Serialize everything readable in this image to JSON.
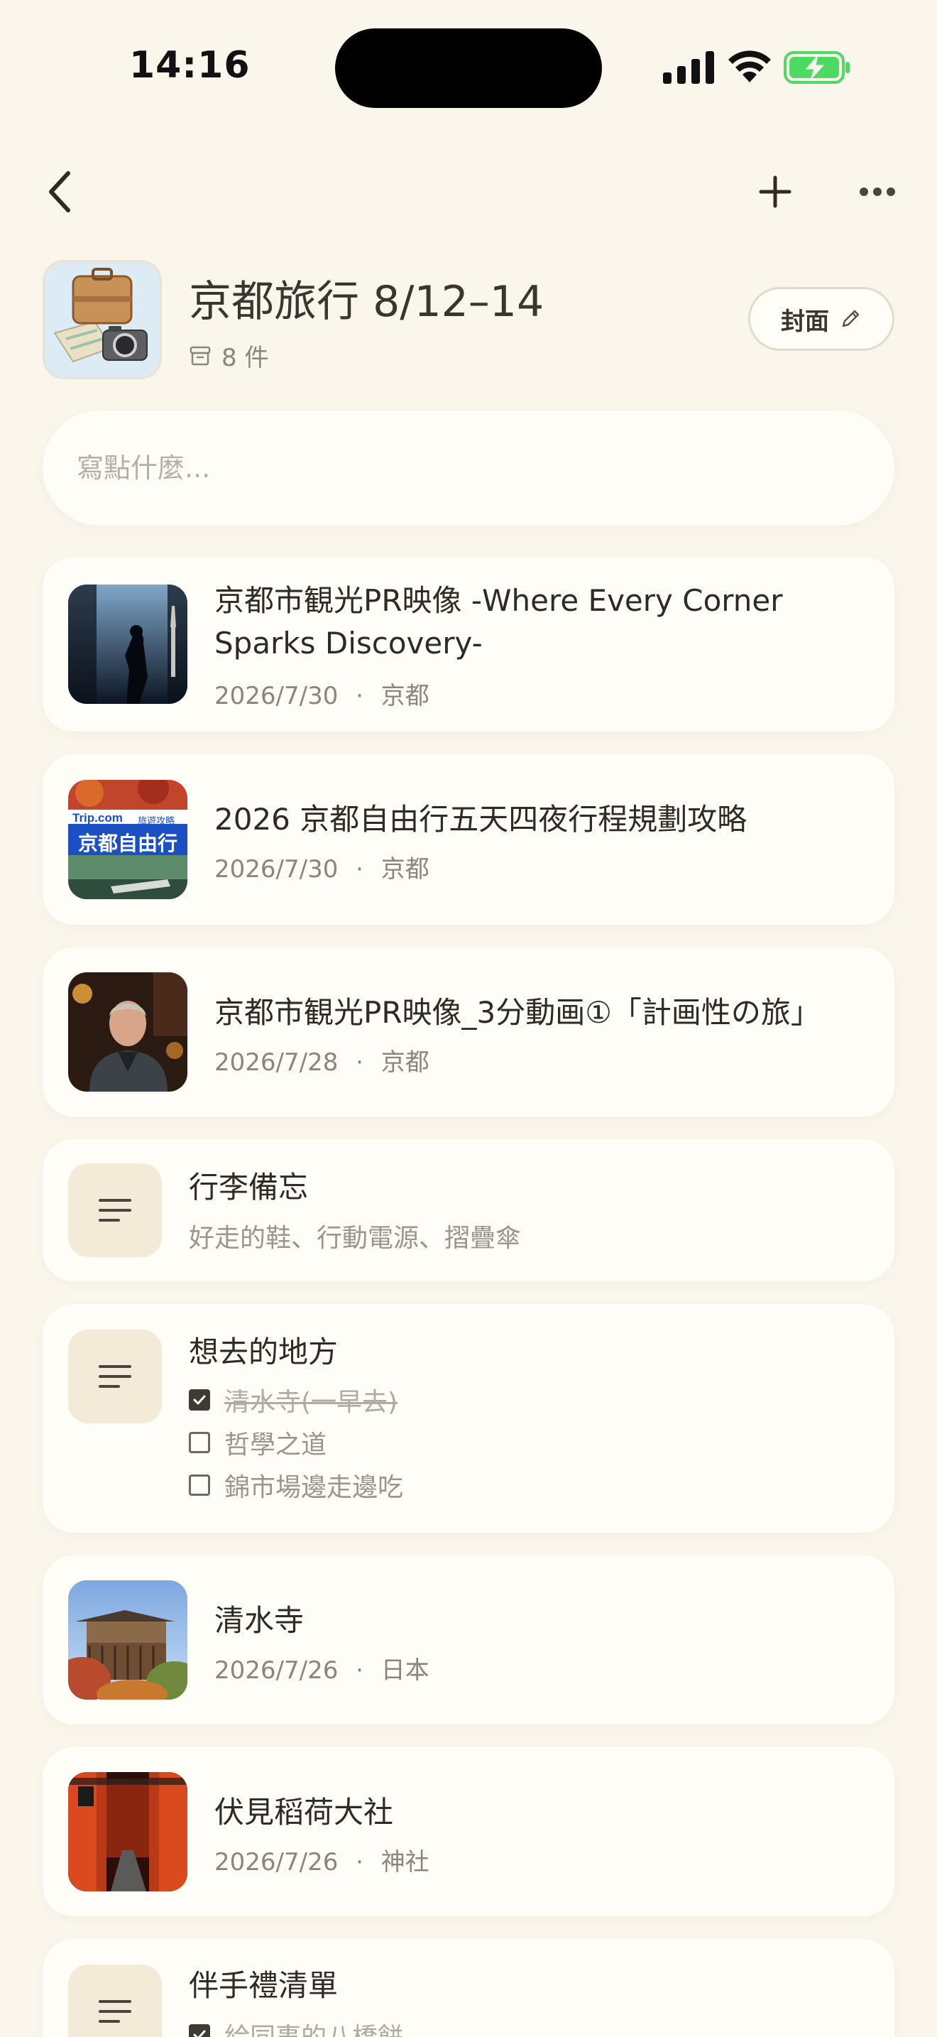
{
  "status": {
    "time": "14:16"
  },
  "nav": {
    "back_icon": "chevron-left-icon",
    "add_icon": "plus-icon",
    "more_icon": "ellipsis-icon"
  },
  "header": {
    "title": "京都旅行 8/12–14",
    "count": "8 件",
    "cover_button": "封面"
  },
  "composer": {
    "placeholder": "寫點什麼..."
  },
  "items": [
    {
      "type": "link",
      "title": "京都市観光PR映像 -Where Every Corner Sparks Discovery-",
      "date": "2026/7/30",
      "sep": "·",
      "tag": "京都"
    },
    {
      "type": "link",
      "title": "2026 京都自由行五天四夜行程規劃攻略",
      "date": "2026/7/30",
      "sep": "·",
      "tag": "京都",
      "thumb_text": {
        "brand": "Trip.com",
        "brand_sub": "旅遊攻略",
        "banner": "京都自由行"
      }
    },
    {
      "type": "link",
      "title": "京都市観光PR映像_3分動画①「計画性の旅」",
      "date": "2026/7/28",
      "sep": "·",
      "tag": "京都"
    },
    {
      "type": "note",
      "title": "行李備忘",
      "subtitle": "好走的鞋、行動電源、摺疊傘"
    },
    {
      "type": "checklist",
      "title": "想去的地方",
      "checks": [
        {
          "text": "清水寺(一早去)",
          "done": true
        },
        {
          "text": "哲學之道",
          "done": false
        },
        {
          "text": "錦市場邊走邊吃",
          "done": false
        }
      ]
    },
    {
      "type": "place",
      "title": "清水寺",
      "date": "2026/7/26",
      "sep": "·",
      "tag": "日本"
    },
    {
      "type": "place",
      "title": "伏見稻荷大社",
      "date": "2026/7/26",
      "sep": "·",
      "tag": "神社"
    },
    {
      "type": "checklist",
      "title": "伴手禮清單",
      "checks": [
        {
          "text": "給同事的八橋餅",
          "done": true
        }
      ]
    }
  ],
  "colors": {
    "background": "#FBF6EC",
    "card": "#FFFDF8",
    "battery_green": "#4CD964",
    "note_icon_bg": "#F3EAD8"
  }
}
